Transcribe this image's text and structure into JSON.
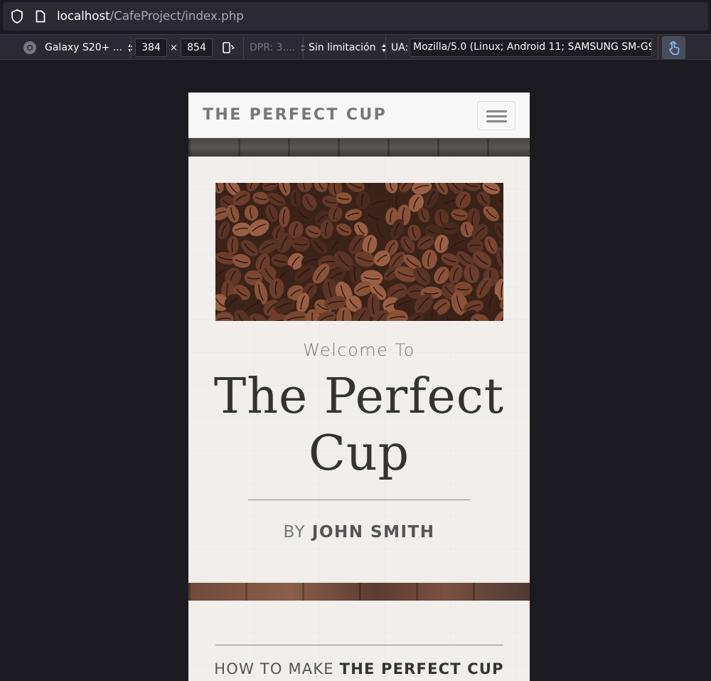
{
  "browser": {
    "url_host": "localhost",
    "url_path": "/CafeProject/index.php"
  },
  "rdm_toolbar": {
    "device": "Galaxy S20+ ...",
    "width": "384",
    "times": "×",
    "height": "854",
    "dpr": "DPR: 3....",
    "throttling": "Sin limitación",
    "ua_label": "UA:",
    "ua_value": "Mozilla/5.0 (Linux; Android 11; SAMSUNG SM-G97"
  },
  "site": {
    "brand": "THE PERFECT CUP",
    "intro": "Welcome To",
    "title_line1": "The Perfect",
    "title_line2": "Cup",
    "by": "BY",
    "author": "JOHN SMITH",
    "howto_prefix": "HOW TO MAKE",
    "howto_strong": "THE PERFECT CUP"
  },
  "icons": [
    "shield-icon",
    "page-icon",
    "chrome-icon",
    "rotate-icon",
    "touch-icon",
    "hamburger-icon"
  ],
  "colors": {
    "browser_bg": "#1c1b22",
    "toolbar_bg": "#2b2a33",
    "navbar_bg": "#f8f8f8",
    "box_bg": "#f1eeec",
    "title_text": "#333333"
  }
}
